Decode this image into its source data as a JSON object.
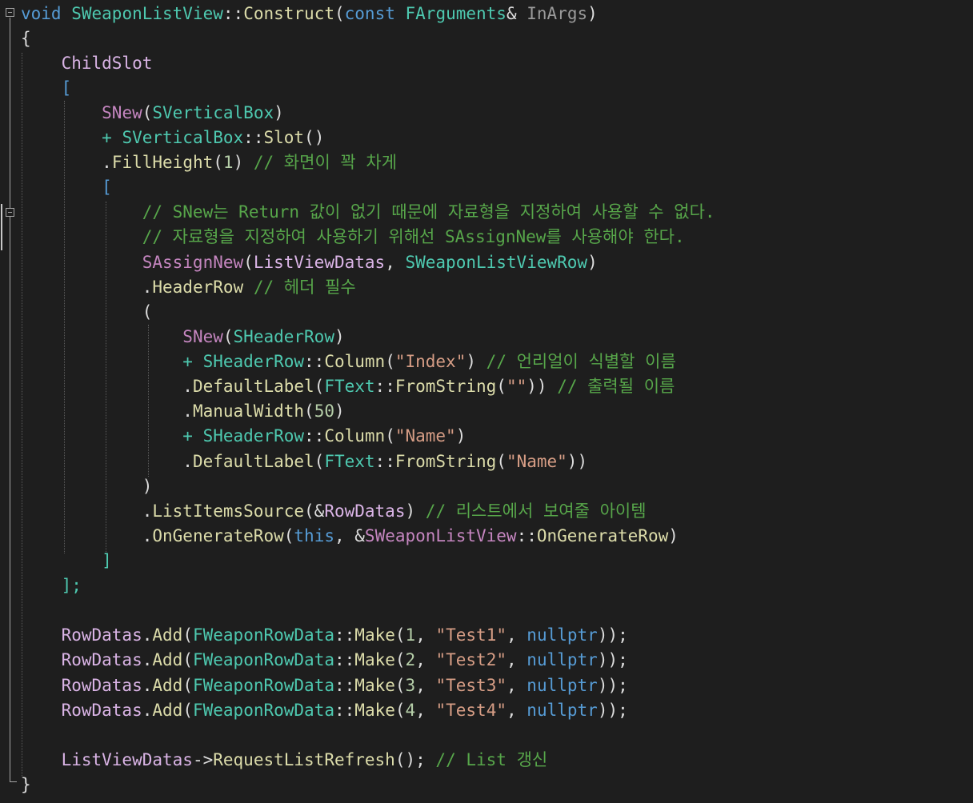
{
  "code": {
    "l01": {
      "void": "void",
      "cls": "SWeaponListView",
      "scope": "::",
      "fn": "Construct",
      "open": "(",
      "const": "const",
      "ty": "FArguments",
      "amp": "&",
      "arg": "InArgs",
      "close": ")"
    },
    "l02": {
      "brace": "{"
    },
    "l03": {
      "slot": "ChildSlot"
    },
    "l04": {
      "br": "["
    },
    "l05": {
      "snew": "SNew",
      "open": "(",
      "ty": "SVerticalBox",
      "close": ")"
    },
    "l06": {
      "plus": "+ ",
      "ty": "SVerticalBox",
      "scope": "::",
      "fn": "Slot",
      "paren": "()"
    },
    "l07": {
      "dot": ".",
      "fn": "FillHeight",
      "open": "(",
      "num": "1",
      "close": ")",
      "cmt": "// 화면이 꽉 차게"
    },
    "l08": {
      "br": "["
    },
    "l09": {
      "cmt": "// SNew는 Return 값이 없기 때문에 자료형을 지정하여 사용할 수 없다."
    },
    "l10": {
      "cmt": "// 자료형을 지정하여 사용하기 위해선 SAssignNew를 사용해야 한다."
    },
    "l11": {
      "macro": "SAssignNew",
      "open": "(",
      "var": "ListViewDatas",
      "comma": ", ",
      "ty": "SWeaponListViewRow",
      "close": ")"
    },
    "l12": {
      "dot": ".",
      "fn": "HeaderRow",
      "cmt": "// 헤더 필수"
    },
    "l13": {
      "p": "("
    },
    "l14": {
      "snew": "SNew",
      "open": "(",
      "ty": "SHeaderRow",
      "close": ")"
    },
    "l15": {
      "plus": "+ ",
      "ty": "SHeaderRow",
      "scope": "::",
      "fn": "Column",
      "open": "(",
      "str": "\"Index\"",
      "close": ")",
      "cmt": "// 언리얼이 식별할 이름"
    },
    "l16": {
      "dot": ".",
      "fn": "DefaultLabel",
      "open": "(",
      "ty": "FText",
      "scope": "::",
      "fn2": "FromString",
      "open2": "(",
      "str": "\"\"",
      "close": "))",
      "cmt": "// 출력될 이름"
    },
    "l17": {
      "dot": ".",
      "fn": "ManualWidth",
      "open": "(",
      "num": "50",
      "close": ")"
    },
    "l18": {
      "plus": "+ ",
      "ty": "SHeaderRow",
      "scope": "::",
      "fn": "Column",
      "open": "(",
      "str": "\"Name\"",
      "close": ")"
    },
    "l19": {
      "dot": ".",
      "fn": "DefaultLabel",
      "open": "(",
      "ty": "FText",
      "scope": "::",
      "fn2": "FromString",
      "open2": "(",
      "str": "\"Name\"",
      "close": "))"
    },
    "l20": {
      "p": ")"
    },
    "l21": {
      "dot": ".",
      "fn": "ListItemsSource",
      "open": "(&",
      "var": "RowDatas",
      "close": ")",
      "cmt": "// 리스트에서 보여줄 아이템"
    },
    "l22": {
      "dot": ".",
      "fn": "OnGenerateRow",
      "open": "(",
      "kw": "this",
      "comma": ", &",
      "cls": "SWeaponListView",
      "scope": "::",
      "fn2": "OnGenerateRow",
      "close": ")"
    },
    "l23": {
      "br": "]"
    },
    "l24": {
      "br": "];"
    },
    "rows": [
      {
        "var": "RowDatas",
        "dot": ".",
        "fn": "Add",
        "open": "(",
        "ty": "FWeaponRowData",
        "scope": "::",
        "fn2": "Make",
        "open2": "(",
        "num": "1",
        "c1": ", ",
        "str": "\"Test1\"",
        "c2": ", ",
        "kw": "nullptr",
        "close": "));"
      },
      {
        "var": "RowDatas",
        "dot": ".",
        "fn": "Add",
        "open": "(",
        "ty": "FWeaponRowData",
        "scope": "::",
        "fn2": "Make",
        "open2": "(",
        "num": "2",
        "c1": ", ",
        "str": "\"Test2\"",
        "c2": ", ",
        "kw": "nullptr",
        "close": "));"
      },
      {
        "var": "RowDatas",
        "dot": ".",
        "fn": "Add",
        "open": "(",
        "ty": "FWeaponRowData",
        "scope": "::",
        "fn2": "Make",
        "open2": "(",
        "num": "3",
        "c1": ", ",
        "str": "\"Test3\"",
        "c2": ", ",
        "kw": "nullptr",
        "close": "));"
      },
      {
        "var": "RowDatas",
        "dot": ".",
        "fn": "Add",
        "open": "(",
        "ty": "FWeaponRowData",
        "scope": "::",
        "fn2": "Make",
        "open2": "(",
        "num": "4",
        "c1": ", ",
        "str": "\"Test4\"",
        "c2": ", ",
        "kw": "nullptr",
        "close": "));"
      }
    ],
    "l30": {
      "var": "ListViewDatas",
      "arrow": "->",
      "fn": "RequestListRefresh",
      "paren": "();",
      "cmt": "// List 갱신"
    },
    "l31": {
      "brace": "}"
    }
  }
}
